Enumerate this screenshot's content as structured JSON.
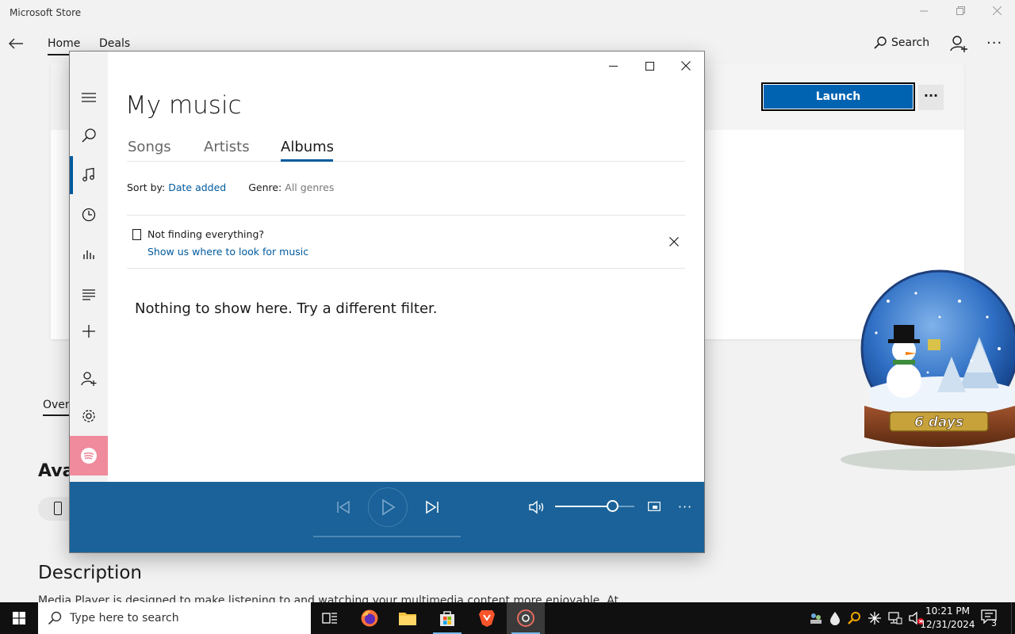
{
  "store": {
    "title": "Microsoft Store",
    "tabs": [
      "Home",
      "Deals"
    ],
    "search_label": "Search",
    "more": "···",
    "launch_label": "Launch",
    "launch_more": "···",
    "overview_tab": "Over",
    "availability_heading": "Ava",
    "description_heading": "Description",
    "description_text": "Media Player is designed to make listening to and watching your multimedia content more enjoyable. At"
  },
  "globe": {
    "countdown": "6 days"
  },
  "media_player": {
    "title": "My music",
    "tabs": {
      "songs": "Songs",
      "artists": "Artists",
      "albums": "Albums"
    },
    "sort_by_label": "Sort by:",
    "sort_by_value": "Date added",
    "genre_label": "Genre:",
    "genre_value": "All genres",
    "notice_title": "Not finding everything?",
    "notice_link": "Show us where to look for music",
    "empty_message": "Nothing to show here. Try a different filter.",
    "volume_level": 0.72,
    "more": "···"
  },
  "taskbar": {
    "search_placeholder": "Type here to search",
    "time": "10:21 PM",
    "date": "12/31/2024",
    "notification_count": "3"
  },
  "colors": {
    "accent": "#005a9e",
    "player_bar": "#1a6299",
    "launch_button": "#0063b1",
    "spotify_tile": "#ef8b9c"
  }
}
